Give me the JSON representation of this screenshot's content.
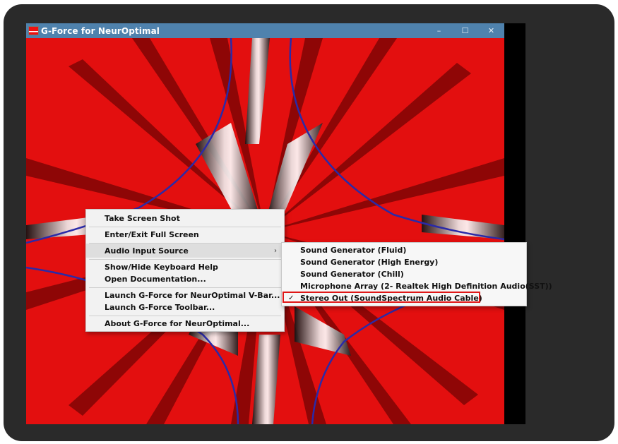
{
  "window": {
    "title": "G-Force for NeurOptimal",
    "controls": {
      "minimize": "–",
      "maximize": "☐",
      "close": "✕"
    }
  },
  "context_menu": {
    "items": [
      {
        "label": "Take Screen Shot"
      },
      {
        "label": "Enter/Exit Full Screen"
      },
      {
        "label": "Audio Input Source",
        "arrow": "›"
      },
      {
        "label": "Show/Hide Keyboard Help"
      },
      {
        "label": "Open Documentation..."
      },
      {
        "label": "Launch G-Force for NeurOptimal V-Bar..."
      },
      {
        "label": "Launch G-Force Toolbar..."
      },
      {
        "label": "About G-Force for NeurOptimal..."
      }
    ]
  },
  "audio_submenu": {
    "items": [
      {
        "label": "Sound Generator (Fluid)"
      },
      {
        "label": "Sound Generator (High Energy)"
      },
      {
        "label": "Sound Generator (Chill)"
      },
      {
        "label": "Microphone Array (2- Realtek High Definition Audio(SST))"
      },
      {
        "label": "Stereo Out (SoundSpectrum Audio Cable)",
        "check": "✓"
      }
    ]
  },
  "colors": {
    "titlebar": "#4f82ad",
    "visualizer_red": "#e30f0f",
    "highlight_box": "#e01818"
  }
}
